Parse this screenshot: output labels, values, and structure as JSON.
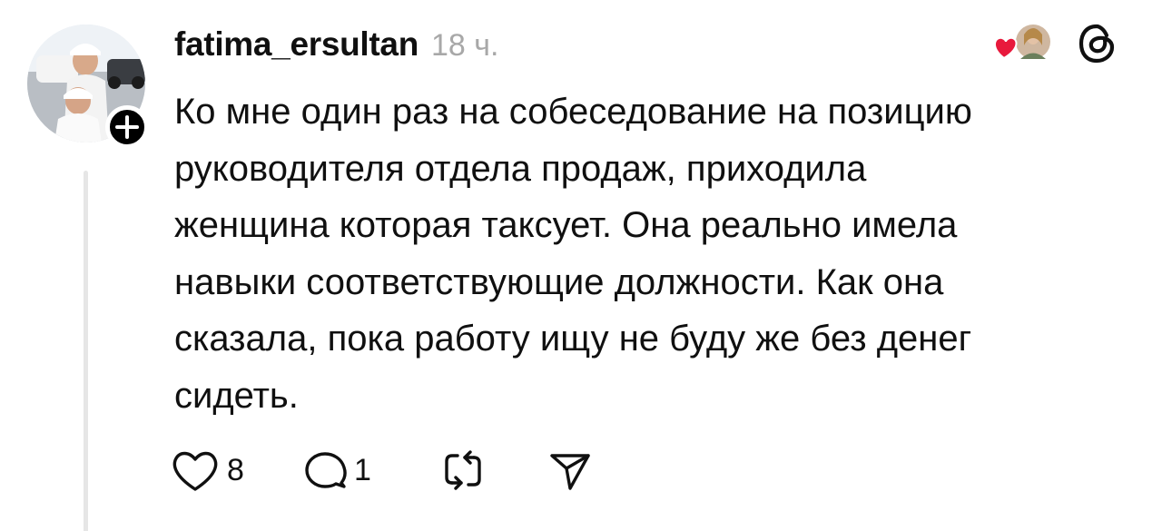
{
  "post": {
    "username": "fatima_ersultan",
    "timestamp": "18 ч.",
    "text_lines": [
      "Ко мне один раз на собеседование на позицию",
      "руководителя отдела продаж, приходила",
      "женщина которая таксует. Она реально имела",
      "навыки соответствующие должности. Как она",
      "сказала, пока работу ищу не буду же без денег",
      "сидеть."
    ],
    "likes": "8",
    "replies": "1"
  },
  "icons": {
    "follow": "plus-icon",
    "liked_by": "heart-with-avatar-icon",
    "app": "threads-logo-icon",
    "like": "heart-outline-icon",
    "reply": "speech-bubble-icon",
    "repost": "repost-icon",
    "share": "send-icon"
  },
  "colors": {
    "text": "#101010",
    "muted": "#a8a8a8",
    "like_red": "#e8193c",
    "thread_line": "#e6e6e6"
  }
}
